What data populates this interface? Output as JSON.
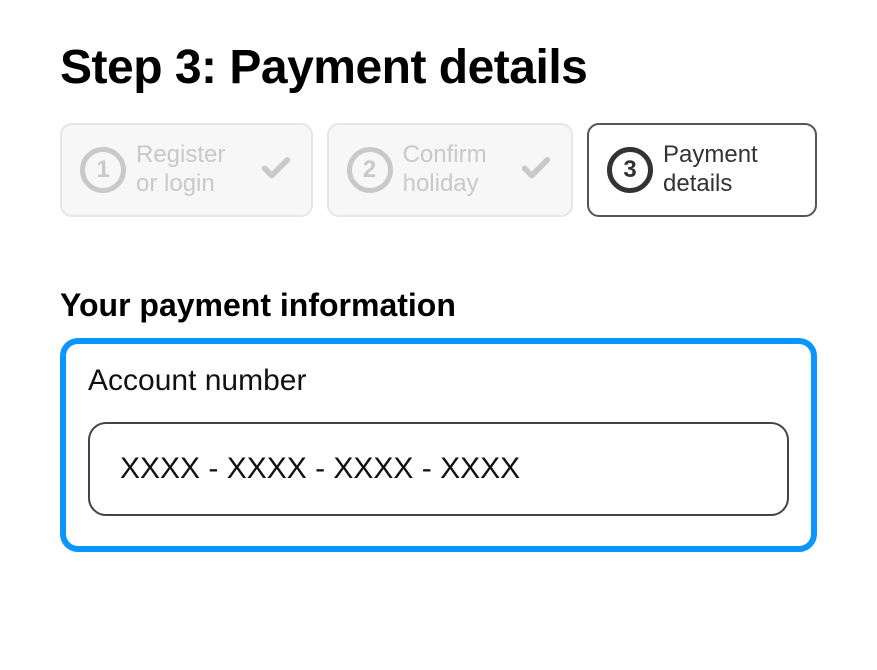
{
  "title": "Step 3: Payment details",
  "steps": [
    {
      "num": "1",
      "label": "Register or login"
    },
    {
      "num": "2",
      "label": "Confirm holiday"
    },
    {
      "num": "3",
      "label": "Payment details"
    }
  ],
  "section_heading": "Your payment information",
  "field": {
    "label": "Account number",
    "value": "XXXX - XXXX - XXXX - XXXX"
  }
}
